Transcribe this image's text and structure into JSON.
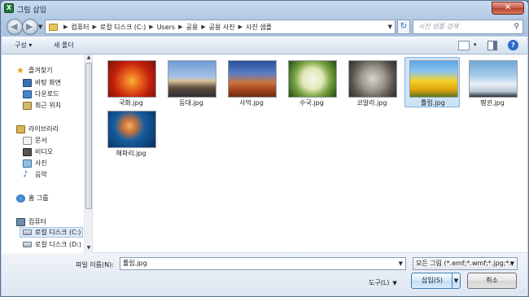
{
  "window": {
    "title": "그림 삽입",
    "app_icon_glyph": "X",
    "close_glyph": "✕"
  },
  "nav": {
    "back_glyph": "◀",
    "forward_glyph": "▶",
    "breadcrumb": [
      "컴퓨터",
      "로컬 디스크 (C:)",
      "Users",
      "공용",
      "공용 사진",
      "사진 샘플"
    ],
    "separator_glyph": "▶",
    "refresh_glyph": "↻",
    "search_placeholder": "사진 샘플 검색",
    "search_icon_glyph": "⚲"
  },
  "toolbar": {
    "organize_label": "구성 ▾",
    "new_folder_label": "새 폴더",
    "help_glyph": "?"
  },
  "sidebar": {
    "favorites": {
      "label": "즐겨찾기",
      "items": [
        "바탕 화면",
        "다운로드",
        "최근 위치"
      ]
    },
    "libraries": {
      "label": "라이브러리",
      "items": [
        "문서",
        "비디오",
        "사진",
        "음악"
      ]
    },
    "homegroup": {
      "label": "홈 그룹"
    },
    "computer": {
      "label": "컴퓨터",
      "items": [
        "로컬 디스크 (C:)",
        "로컬 디스크 (D:)"
      ]
    },
    "star_glyph": "★",
    "music_glyph": "♪"
  },
  "files": [
    {
      "name": "국화.jpg",
      "thumb": "img-chrys"
    },
    {
      "name": "등대.jpg",
      "thumb": "img-lighthouse"
    },
    {
      "name": "사막.jpg",
      "thumb": "img-desert"
    },
    {
      "name": "수국.jpg",
      "thumb": "img-hydrangea"
    },
    {
      "name": "코알라.jpg",
      "thumb": "img-koala"
    },
    {
      "name": "튤립.jpg",
      "thumb": "img-tulips",
      "selected": true
    },
    {
      "name": "펭귄.jpg",
      "thumb": "img-penguins"
    },
    {
      "name": "해파리.jpg",
      "thumb": "img-jelly"
    }
  ],
  "bottom": {
    "file_name_label": "파일 이름(N):",
    "file_name_value": "튤립.jpg",
    "file_type_value": "모든 그림 (*.emf;*.wmf;*.jpg;*.",
    "tools_label": "도구(L)",
    "insert_label": "삽입(S)",
    "cancel_label": "취소"
  },
  "colors": {
    "selection": "#cde4f7",
    "accent": "#3c7fb1"
  }
}
